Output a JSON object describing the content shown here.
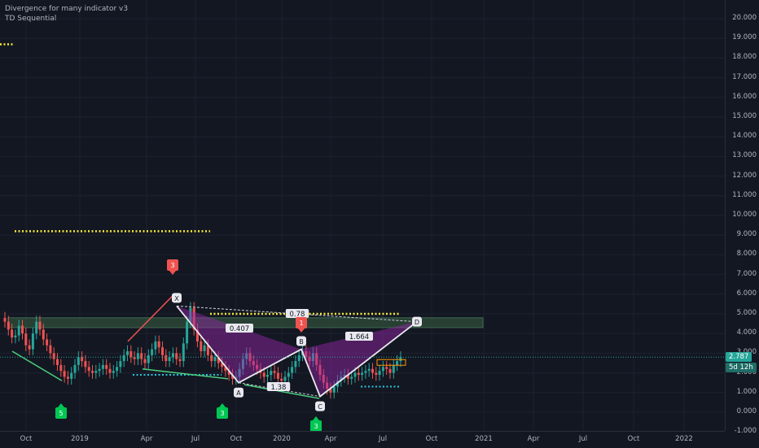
{
  "indicators": [
    "Divergence for many indicator v3",
    "TD Sequential"
  ],
  "colors": {
    "background": "#131722",
    "up": "#26a69a",
    "down": "#ef5350",
    "pattern": "#9c27b0",
    "dots": "#f5eb35",
    "grid": "#1e2230"
  },
  "badges": {
    "price": "2.787",
    "countdown": "5d 12h"
  },
  "chart_data": {
    "type": "candlestick",
    "ylim": [
      -1,
      20.5
    ],
    "y_ticks": [
      "20.000",
      "19.000",
      "18.000",
      "17.000",
      "16.000",
      "15.000",
      "14.000",
      "13.000",
      "12.000",
      "11.000",
      "10.000",
      "9.000",
      "8.000",
      "7.000",
      "6.000",
      "5.000",
      "4.000",
      "3.000",
      "2.000",
      "1.000",
      "0.000",
      "-1.000"
    ],
    "x_ticks": [
      "Oct",
      "2019",
      "Apr",
      "Jul",
      "Oct",
      "2020",
      "Apr",
      "Jul",
      "Oct",
      "2021",
      "Apr",
      "Jul",
      "Oct",
      "2022"
    ],
    "close_series": [
      4.6,
      4.2,
      3.8,
      3.9,
      4.4,
      4.0,
      3.4,
      3.2,
      4.0,
      4.6,
      4.2,
      3.7,
      3.4,
      3.0,
      2.7,
      2.4,
      2.1,
      1.8,
      1.7,
      2.0,
      2.4,
      2.8,
      2.6,
      2.3,
      2.1,
      2.0,
      2.1,
      2.2,
      2.4,
      2.2,
      2.0,
      2.1,
      2.3,
      2.6,
      2.9,
      3.1,
      2.8,
      2.7,
      3.0,
      2.7,
      2.5,
      2.9,
      3.2,
      3.6,
      3.3,
      2.9,
      2.6,
      2.8,
      3.0,
      2.7,
      2.6,
      3.5,
      4.6,
      5.3,
      4.2,
      3.6,
      3.1,
      3.4,
      2.9,
      2.6,
      2.8,
      2.5,
      2.3,
      2.1,
      1.9,
      1.7,
      1.8,
      2.2,
      2.7,
      3.0,
      2.6,
      2.4,
      2.2,
      2.0,
      1.8,
      1.9,
      2.1,
      2.0,
      1.7,
      1.6,
      1.8,
      2.0,
      2.3,
      2.6,
      2.9,
      3.1,
      2.8,
      2.6,
      3.0,
      2.4,
      1.9,
      1.5,
      1.2,
      1.0,
      1.3,
      1.6,
      1.8,
      1.9,
      1.7,
      1.8,
      2.0,
      1.9,
      2.0,
      2.1,
      2.2,
      2.0,
      1.9,
      2.1,
      2.3,
      2.2,
      2.0,
      2.4,
      2.6,
      2.8
    ],
    "harmonic_pattern": {
      "points": [
        "X",
        "A",
        "B",
        "C",
        "D"
      ],
      "values": [
        5.4,
        1.5,
        3.2,
        0.8,
        4.6
      ],
      "ratios": [
        "0.407",
        "1.38",
        "1.664",
        "0.78"
      ]
    },
    "td_labels": [
      "3",
      "5",
      "3",
      "1",
      "3"
    ],
    "resistance_dots": [
      9.2,
      5.0,
      18.7
    ],
    "support_dots": [
      1.9,
      1.3
    ],
    "zone": [
      4.3,
      4.8
    ]
  }
}
